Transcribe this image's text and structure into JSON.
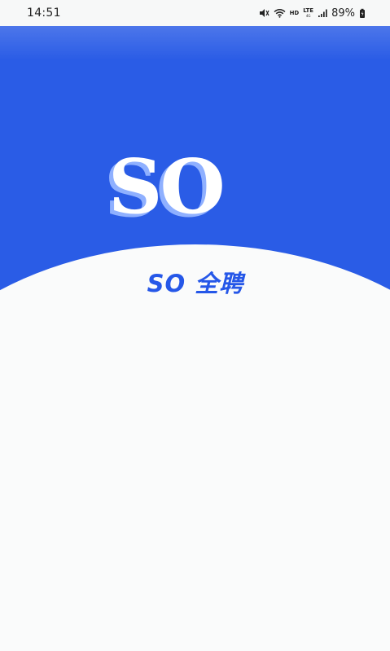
{
  "status_bar": {
    "time": "14:51",
    "icons": [
      "mute-icon",
      "wifi-icon",
      "hd-icon",
      "lte-icon",
      "signal-icon",
      "battery-icon"
    ],
    "hd": "HD",
    "lte": "LTE",
    "lte_sub": "4G",
    "battery": "89%"
  },
  "splash": {
    "logo": "SO",
    "brand_name": "SO 全聘"
  },
  "colors": {
    "primary": "#2a5ce6",
    "text_blue": "#2557e8",
    "background": "#fafbfb"
  }
}
